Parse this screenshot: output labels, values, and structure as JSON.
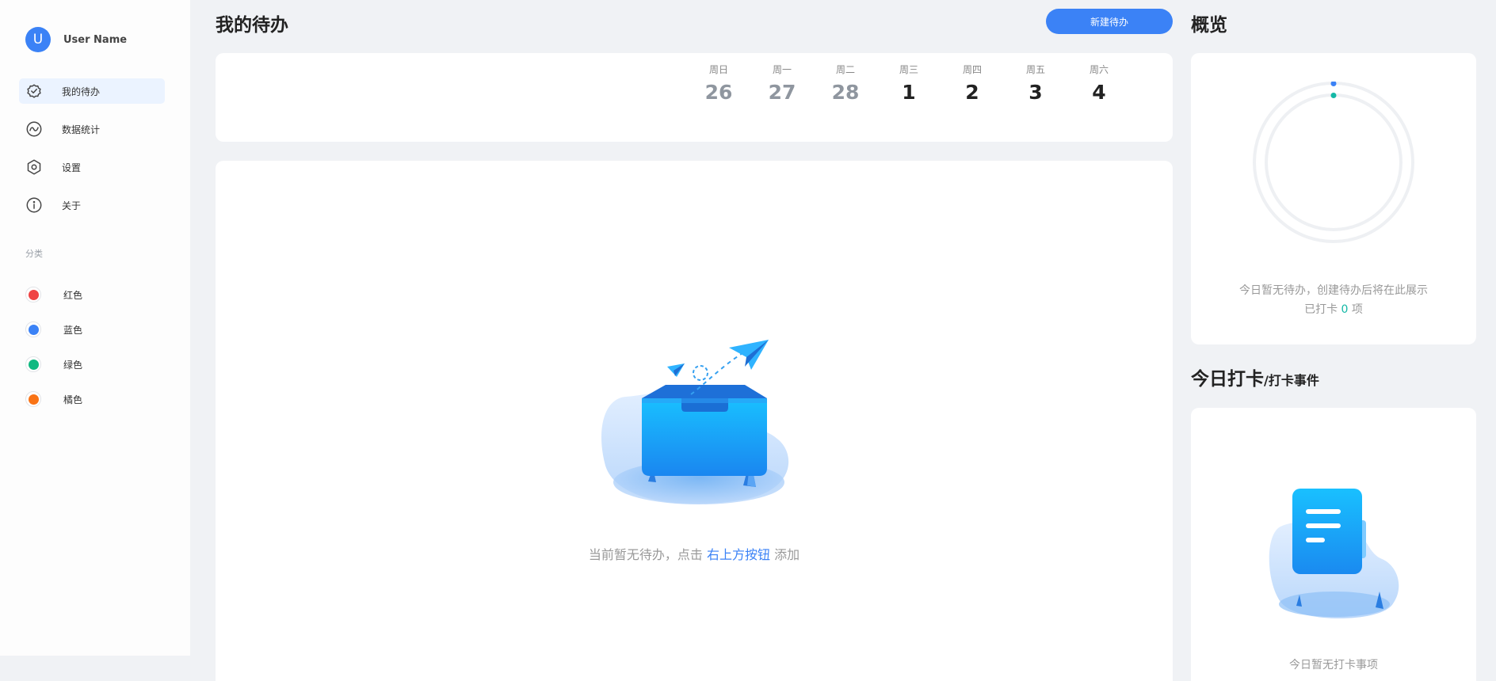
{
  "user": {
    "avatar_letter": "U",
    "name": "User Name"
  },
  "nav": {
    "items": [
      {
        "label": "我的待办",
        "icon": "check-shield-icon",
        "active": true
      },
      {
        "label": "数据统计",
        "icon": "chart-wave-icon",
        "active": false
      },
      {
        "label": "设置",
        "icon": "gear-hexagon-icon",
        "active": false
      },
      {
        "label": "关于",
        "icon": "info-icon",
        "active": false
      }
    ]
  },
  "categories": {
    "title": "分类",
    "items": [
      {
        "label": "红色",
        "color": "#ef4444"
      },
      {
        "label": "蓝色",
        "color": "#3b82f6"
      },
      {
        "label": "绿色",
        "color": "#10b981"
      },
      {
        "label": "橘色",
        "color": "#f97316"
      }
    ]
  },
  "main": {
    "title": "我的待办",
    "new_button": "新建待办",
    "week": [
      {
        "name": "周日",
        "num": "26",
        "past": true
      },
      {
        "name": "周一",
        "num": "27",
        "past": true
      },
      {
        "name": "周二",
        "num": "28",
        "past": true
      },
      {
        "name": "周三",
        "num": "1",
        "past": false
      },
      {
        "name": "周四",
        "num": "2",
        "past": false
      },
      {
        "name": "周五",
        "num": "3",
        "past": false
      },
      {
        "name": "周六",
        "num": "4",
        "past": false
      }
    ],
    "empty": {
      "prefix": "当前暂无待办，点击",
      "link": "右上方按钮",
      "suffix": "添加"
    }
  },
  "overview": {
    "title": "概览",
    "empty_text": "今日暂无待办，创建待办后将在此展示",
    "count_prefix": "已打卡",
    "count": "0",
    "count_suffix": "项"
  },
  "punch": {
    "title": "今日打卡",
    "subtitle": "/打卡事件",
    "empty_text": "今日暂无打卡事项"
  },
  "colors": {
    "accent": "#3b82f6",
    "teal": "#14b8a6"
  }
}
